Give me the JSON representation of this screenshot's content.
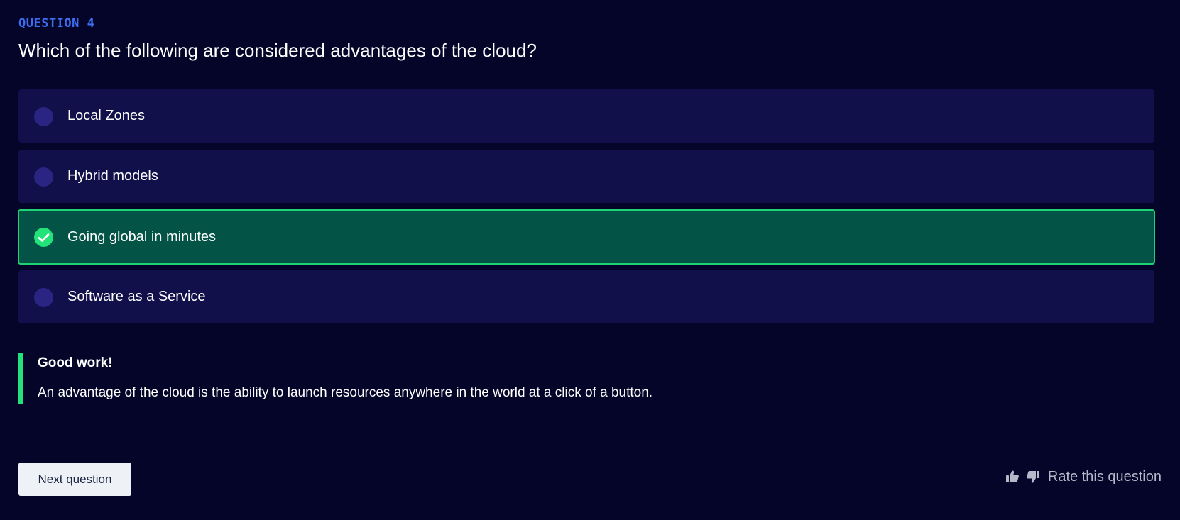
{
  "question": {
    "label": "QUESTION 4",
    "text": "Which of the following are considered advantages of the cloud?"
  },
  "options": [
    {
      "label": "Local Zones",
      "state": "unselected"
    },
    {
      "label": "Hybrid models",
      "state": "unselected"
    },
    {
      "label": "Going global in minutes",
      "state": "correct"
    },
    {
      "label": "Software as a Service",
      "state": "unselected"
    }
  ],
  "feedback": {
    "title": "Good work!",
    "text": "An advantage of the cloud is the ability to launch resources anywhere in the world at a click of a button."
  },
  "footer": {
    "next_label": "Next question",
    "rate_label": "Rate this question",
    "icons": [
      "thumbs-up-icon",
      "thumbs-down-icon"
    ]
  },
  "colors": {
    "background": "#05052a",
    "accent": "#3d6df0",
    "option_bg": "#11104a",
    "correct_bg": "#035446",
    "correct_border": "#1fd274"
  }
}
